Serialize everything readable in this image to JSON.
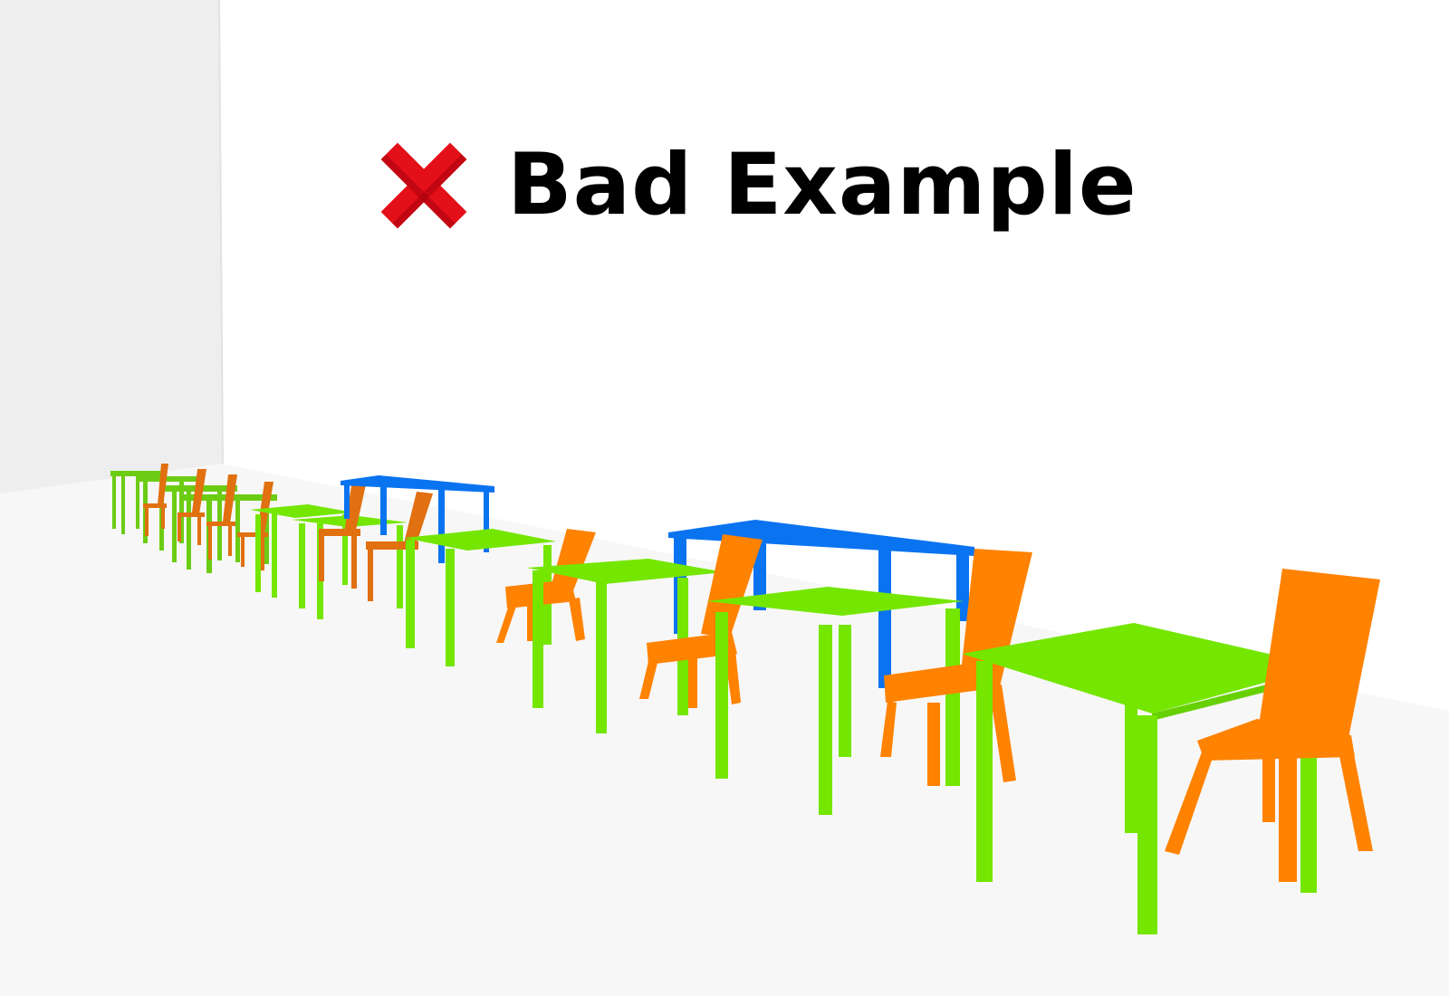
{
  "heading": {
    "text": "Bad Example",
    "icon": "cross-mark-icon"
  },
  "colors": {
    "cross": "#e3101a",
    "cross_shade": "#a8000c",
    "table": "#74e600",
    "table_far": "#6ccc14",
    "desk": "#0a73f0",
    "chair": "#ff8200",
    "chair_far": "#e07010",
    "wall": "#eeeeee",
    "floor": "#f7f7f7"
  }
}
